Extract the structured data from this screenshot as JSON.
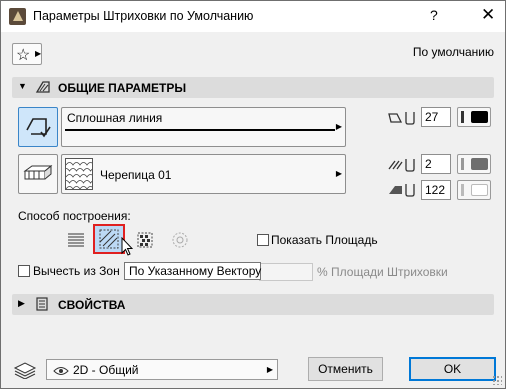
{
  "window": {
    "title": "Параметры Штриховки по Умолчанию",
    "help_label": "?",
    "close_label": "✕"
  },
  "favorites": {
    "default_label": "По умолчанию"
  },
  "general_section": {
    "title": "ОБЩИЕ ПАРАМЕТРЫ",
    "expanded": true,
    "line_type": "Сплошная линия",
    "fill_type": "Черепица 01",
    "contour_pen": "27",
    "fill_pen": "2",
    "background_pen": "122",
    "method_label": "Способ построения:",
    "methods": [
      "horizontal-lines",
      "vector-fill",
      "local-pattern",
      "radial-fill"
    ],
    "active_method": "vector-fill",
    "show_area_label": "Показать Площадь",
    "show_area_checked": false,
    "subtract_zones_label": "Вычесть из Зон",
    "subtract_zones_checked": false,
    "fill_area_pct_label": "% Площади Штриховки"
  },
  "tooltip": {
    "text": "По Указанному Вектору"
  },
  "properties_section": {
    "title": "СВОЙСТВА",
    "expanded": false
  },
  "footer": {
    "layer": "2D - Общий",
    "cancel_label": "Отменить",
    "ok_label": "OK"
  },
  "colors": {
    "accent": "#0078d7",
    "selected_bg": "#cfe6fa",
    "highlight_border": "#e02020"
  }
}
